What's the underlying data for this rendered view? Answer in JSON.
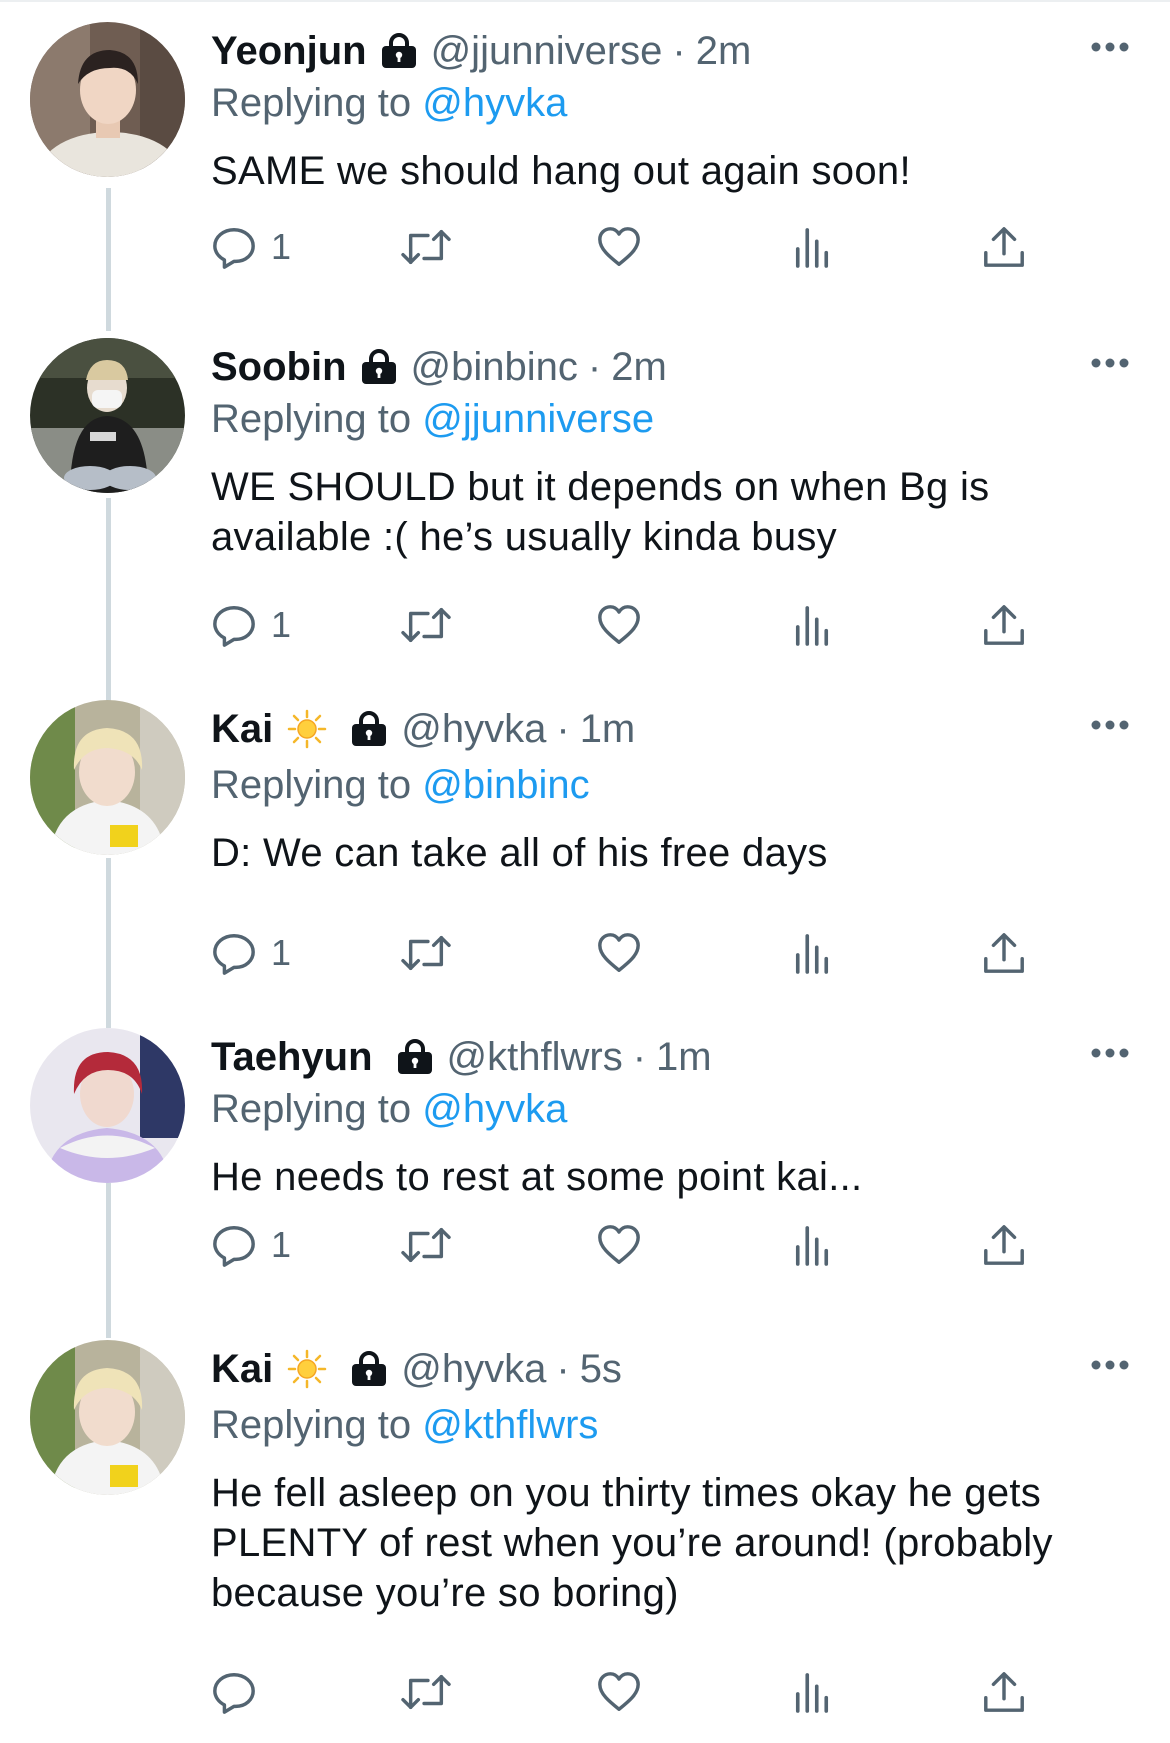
{
  "colors": {
    "link": "#1d9bf0",
    "secondary": "#536471",
    "text": "#0f1419",
    "thread_line": "#cfd9de"
  },
  "tweets": [
    {
      "name": "Yeonjun",
      "has_sun_emoji": false,
      "protected_icon": "lock-icon",
      "handle": "@jjunniverse",
      "dot": "·",
      "time": "2m",
      "replying_label": "Replying to",
      "replying_to": "@hyvka",
      "text": "SAME we should hang out again soon!",
      "reply_count": "1"
    },
    {
      "name": "Soobin",
      "has_sun_emoji": false,
      "protected_icon": "lock-icon",
      "handle": "@binbinc",
      "dot": "·",
      "time": "2m",
      "replying_label": "Replying to",
      "replying_to": "@jjunniverse",
      "text": "WE SHOULD but it depends on when Bg is available :( he’s usually kinda busy",
      "reply_count": "1"
    },
    {
      "name": "Kai",
      "has_sun_emoji": true,
      "protected_icon": "lock-icon",
      "handle": "@hyvka",
      "dot": "·",
      "time": "1m",
      "replying_label": "Replying to",
      "replying_to": "@binbinc",
      "text": "D: We can take all of his free days",
      "reply_count": "1"
    },
    {
      "name": "Taehyun",
      "has_sun_emoji": false,
      "protected_icon": "lock-icon",
      "handle": "@kthflwrs",
      "dot": "·",
      "time": "1m",
      "replying_label": "Replying to",
      "replying_to": "@hyvka",
      "text": "He needs to rest at some point kai...",
      "reply_count": "1"
    },
    {
      "name": "Kai",
      "has_sun_emoji": true,
      "protected_icon": "lock-icon",
      "handle": "@hyvka",
      "dot": "·",
      "time": "5s",
      "replying_label": "Replying to",
      "replying_to": "@kthflwrs",
      "text": "He fell asleep on you thirty times okay he gets PLENTY of rest when you’re around! (probably because you’re so boring)",
      "reply_count": ""
    }
  ],
  "action_icons": [
    "reply-icon",
    "retweet-icon",
    "like-icon",
    "views-icon",
    "share-icon"
  ]
}
